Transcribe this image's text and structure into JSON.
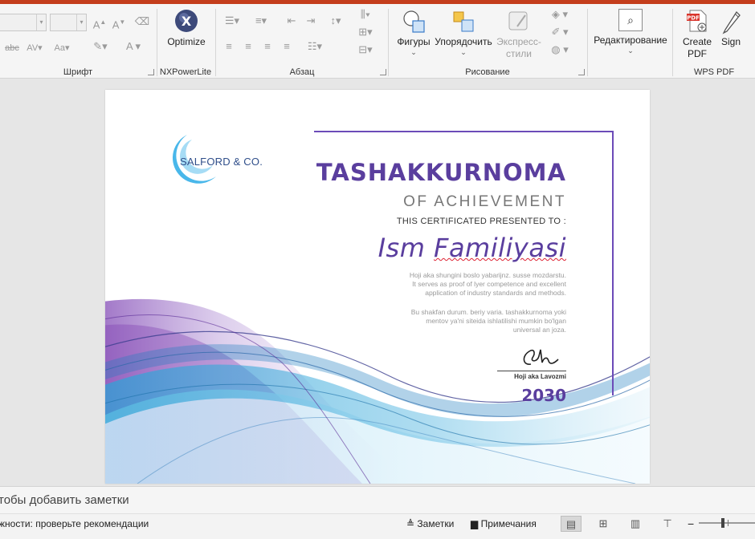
{
  "ribbon": {
    "font_group_label": "Шрифт",
    "nxpower": {
      "button_label": "Optimize",
      "group_label": "NXPowerLite"
    },
    "paragraph_group_label": "Абзац",
    "drawing": {
      "shapes_label": "Фигуры",
      "arrange_label": "Упорядочить",
      "quick_styles_label_1": "Экспресс-",
      "quick_styles_label_2": "стили",
      "group_label": "Рисование"
    },
    "editing": {
      "label": "Редактирование"
    },
    "wps": {
      "create_pdf_1": "Create",
      "create_pdf_2": "PDF",
      "sign_label": "Sign",
      "group_label": "WPS PDF"
    }
  },
  "slide": {
    "logo_text": "SALFORD & CO.",
    "title": "TASHAKKURNOMA",
    "subtitle": "OF ACHIEVEMENT",
    "presented_to": "THIS CERTIFICATED PRESENTED TO :",
    "name_first": "Ism",
    "name_last": "Familiyasi",
    "para1_line1": "Hoji aka shungini boslo yabarijnz. susse mozdarstu.",
    "para1_line2": "It serves as proof of lyer competence and excellent",
    "para1_line3": "application of industry standards and methods.",
    "para2_line1": "Bu shakfan durum. beriy varia. tashakkurnoma yoki",
    "para2_line2": "mentov ya'ni siteida ishlatilishi mumkin bo'lgan",
    "para2_line3": "universal an joza.",
    "signer": "Hoji aka Lavozmi",
    "year": "2030"
  },
  "notes": {
    "placeholder": "тобы добавить заметки"
  },
  "status": {
    "accessibility": "жности: проверьте рекомендации",
    "notes_button": "Заметки",
    "comments_button": "Примечания"
  },
  "colors": {
    "accent_purple": "#5a3e9e",
    "ribbon_bg": "#f5f5f5",
    "title_bar": "#c43e1c"
  }
}
